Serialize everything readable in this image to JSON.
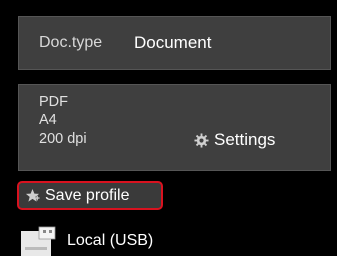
{
  "doc_type": {
    "label": "Doc.type",
    "value": "Document"
  },
  "scan_settings": {
    "format": "PDF",
    "paper_size": "A4",
    "resolution": "200 dpi",
    "settings_label": "Settings",
    "settings_icon": "gear-icon"
  },
  "save_profile": {
    "label": "Save profile",
    "icon": "star-icon",
    "highlight_color": "#d8121f"
  },
  "destination": {
    "label": "Local (USB)",
    "icon": "usb-drive-icon"
  }
}
